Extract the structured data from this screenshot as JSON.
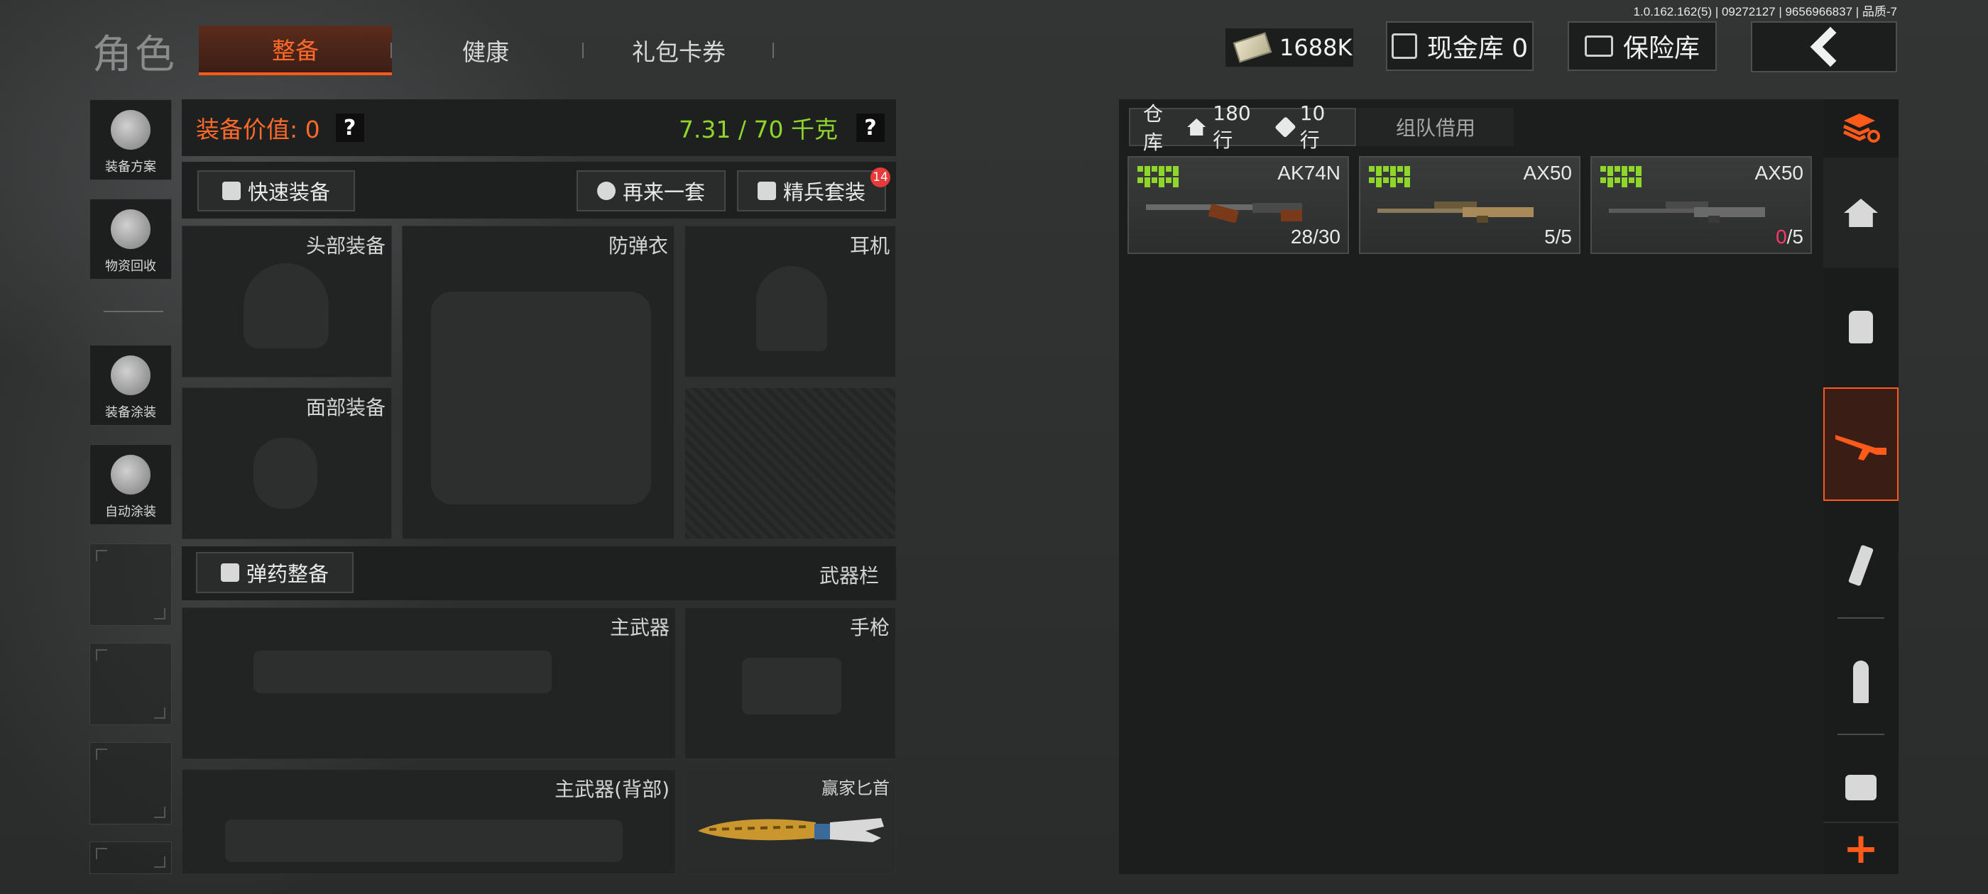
{
  "version_text": "1.0.162.162(5) | 09272127 | 9656966837 | 品质-7",
  "header": {
    "role_title": "角色",
    "tabs": [
      "整备",
      "健康",
      "礼包卡券"
    ],
    "money": "1688K",
    "cash_vault_label": "现金库 0",
    "insurance_label": "保险库"
  },
  "sidebar": {
    "items": [
      "装备方案",
      "物资回收",
      "装备涂装",
      "自动涂装"
    ]
  },
  "equipment": {
    "value_label": "装备价值: 0",
    "weight_label": "7.31 / 70 千克",
    "question_mark": "?",
    "quick_equip": "快速装备",
    "again_set": "再来一套",
    "elite_set": "精兵套装",
    "elite_badge": "14",
    "slots": {
      "head": "头部装备",
      "armor": "防弹衣",
      "headset": "耳机",
      "face": "面部装备"
    },
    "ammo_button": "弹药整备",
    "weapon_bar_label": "武器栏",
    "weapon_slots": {
      "primary": "主武器",
      "pistol": "手枪",
      "primary_back": "主武器(背部)",
      "knife": "赢家匕首"
    }
  },
  "warehouse": {
    "tab_label": "仓库",
    "rows_house": "180行",
    "rows_tag": "10行",
    "team_borrow": "组队借用",
    "items": [
      {
        "name": "AK74N",
        "ammo_current": "28",
        "ammo_total": "/30",
        "zero": false
      },
      {
        "name": "AX50",
        "ammo_current": "5",
        "ammo_total": "/5",
        "zero": false
      },
      {
        "name": "AX50",
        "ammo_current": "0",
        "ammo_total": "/5",
        "zero": true
      }
    ]
  },
  "categories": [
    "stack-refresh-icon",
    "home-icon",
    "vest-icon",
    "rifle-icon",
    "magazine-icon",
    "bullet-icon",
    "scope-icon",
    "plus-icon"
  ],
  "colors": {
    "accent": "#ff5a1a",
    "weight_green": "#8fd62c",
    "badge_red": "#e83a3a"
  }
}
